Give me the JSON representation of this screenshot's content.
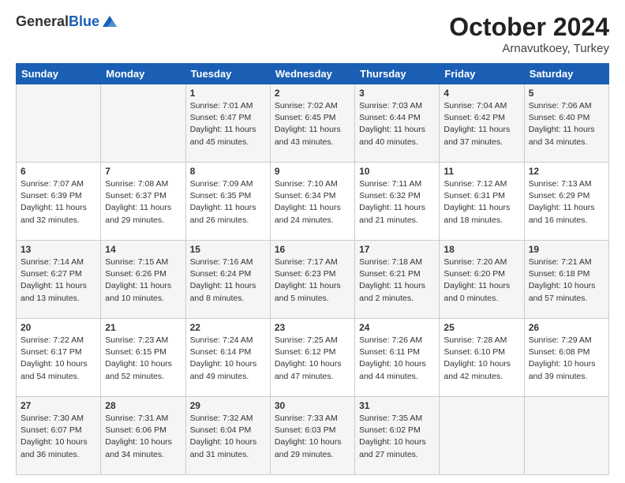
{
  "header": {
    "logo_general": "General",
    "logo_blue": "Blue",
    "month": "October 2024",
    "location": "Arnavutkoey, Turkey"
  },
  "days_of_week": [
    "Sunday",
    "Monday",
    "Tuesday",
    "Wednesday",
    "Thursday",
    "Friday",
    "Saturday"
  ],
  "weeks": [
    [
      {
        "day": "",
        "info": ""
      },
      {
        "day": "",
        "info": ""
      },
      {
        "day": "1",
        "info": "Sunrise: 7:01 AM\nSunset: 6:47 PM\nDaylight: 11 hours and 45 minutes."
      },
      {
        "day": "2",
        "info": "Sunrise: 7:02 AM\nSunset: 6:45 PM\nDaylight: 11 hours and 43 minutes."
      },
      {
        "day": "3",
        "info": "Sunrise: 7:03 AM\nSunset: 6:44 PM\nDaylight: 11 hours and 40 minutes."
      },
      {
        "day": "4",
        "info": "Sunrise: 7:04 AM\nSunset: 6:42 PM\nDaylight: 11 hours and 37 minutes."
      },
      {
        "day": "5",
        "info": "Sunrise: 7:06 AM\nSunset: 6:40 PM\nDaylight: 11 hours and 34 minutes."
      }
    ],
    [
      {
        "day": "6",
        "info": "Sunrise: 7:07 AM\nSunset: 6:39 PM\nDaylight: 11 hours and 32 minutes."
      },
      {
        "day": "7",
        "info": "Sunrise: 7:08 AM\nSunset: 6:37 PM\nDaylight: 11 hours and 29 minutes."
      },
      {
        "day": "8",
        "info": "Sunrise: 7:09 AM\nSunset: 6:35 PM\nDaylight: 11 hours and 26 minutes."
      },
      {
        "day": "9",
        "info": "Sunrise: 7:10 AM\nSunset: 6:34 PM\nDaylight: 11 hours and 24 minutes."
      },
      {
        "day": "10",
        "info": "Sunrise: 7:11 AM\nSunset: 6:32 PM\nDaylight: 11 hours and 21 minutes."
      },
      {
        "day": "11",
        "info": "Sunrise: 7:12 AM\nSunset: 6:31 PM\nDaylight: 11 hours and 18 minutes."
      },
      {
        "day": "12",
        "info": "Sunrise: 7:13 AM\nSunset: 6:29 PM\nDaylight: 11 hours and 16 minutes."
      }
    ],
    [
      {
        "day": "13",
        "info": "Sunrise: 7:14 AM\nSunset: 6:27 PM\nDaylight: 11 hours and 13 minutes."
      },
      {
        "day": "14",
        "info": "Sunrise: 7:15 AM\nSunset: 6:26 PM\nDaylight: 11 hours and 10 minutes."
      },
      {
        "day": "15",
        "info": "Sunrise: 7:16 AM\nSunset: 6:24 PM\nDaylight: 11 hours and 8 minutes."
      },
      {
        "day": "16",
        "info": "Sunrise: 7:17 AM\nSunset: 6:23 PM\nDaylight: 11 hours and 5 minutes."
      },
      {
        "day": "17",
        "info": "Sunrise: 7:18 AM\nSunset: 6:21 PM\nDaylight: 11 hours and 2 minutes."
      },
      {
        "day": "18",
        "info": "Sunrise: 7:20 AM\nSunset: 6:20 PM\nDaylight: 11 hours and 0 minutes."
      },
      {
        "day": "19",
        "info": "Sunrise: 7:21 AM\nSunset: 6:18 PM\nDaylight: 10 hours and 57 minutes."
      }
    ],
    [
      {
        "day": "20",
        "info": "Sunrise: 7:22 AM\nSunset: 6:17 PM\nDaylight: 10 hours and 54 minutes."
      },
      {
        "day": "21",
        "info": "Sunrise: 7:23 AM\nSunset: 6:15 PM\nDaylight: 10 hours and 52 minutes."
      },
      {
        "day": "22",
        "info": "Sunrise: 7:24 AM\nSunset: 6:14 PM\nDaylight: 10 hours and 49 minutes."
      },
      {
        "day": "23",
        "info": "Sunrise: 7:25 AM\nSunset: 6:12 PM\nDaylight: 10 hours and 47 minutes."
      },
      {
        "day": "24",
        "info": "Sunrise: 7:26 AM\nSunset: 6:11 PM\nDaylight: 10 hours and 44 minutes."
      },
      {
        "day": "25",
        "info": "Sunrise: 7:28 AM\nSunset: 6:10 PM\nDaylight: 10 hours and 42 minutes."
      },
      {
        "day": "26",
        "info": "Sunrise: 7:29 AM\nSunset: 6:08 PM\nDaylight: 10 hours and 39 minutes."
      }
    ],
    [
      {
        "day": "27",
        "info": "Sunrise: 7:30 AM\nSunset: 6:07 PM\nDaylight: 10 hours and 36 minutes."
      },
      {
        "day": "28",
        "info": "Sunrise: 7:31 AM\nSunset: 6:06 PM\nDaylight: 10 hours and 34 minutes."
      },
      {
        "day": "29",
        "info": "Sunrise: 7:32 AM\nSunset: 6:04 PM\nDaylight: 10 hours and 31 minutes."
      },
      {
        "day": "30",
        "info": "Sunrise: 7:33 AM\nSunset: 6:03 PM\nDaylight: 10 hours and 29 minutes."
      },
      {
        "day": "31",
        "info": "Sunrise: 7:35 AM\nSunset: 6:02 PM\nDaylight: 10 hours and 27 minutes."
      },
      {
        "day": "",
        "info": ""
      },
      {
        "day": "",
        "info": ""
      }
    ]
  ]
}
